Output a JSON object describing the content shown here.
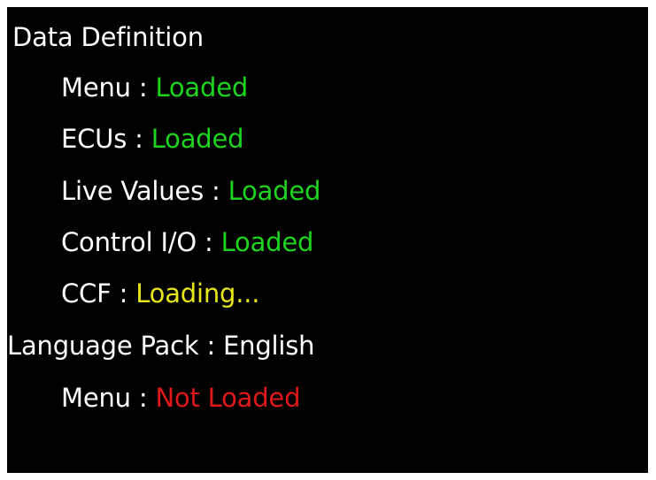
{
  "colors": {
    "background": "#000000",
    "label": "#ffffff",
    "loaded": "#1ed51e",
    "loading": "#e6e619",
    "not_loaded": "#e01818"
  },
  "data_definition": {
    "heading": "Data Definition",
    "items": [
      {
        "label": "Menu",
        "separator": " : ",
        "status": "Loaded",
        "state": "loaded"
      },
      {
        "label": "ECUs",
        "separator": " : ",
        "status": "Loaded",
        "state": "loaded"
      },
      {
        "label": "Live Values",
        "separator": " : ",
        "status": "Loaded",
        "state": "loaded"
      },
      {
        "label": "Control I/O",
        "separator": " : ",
        "status": "Loaded",
        "state": "loaded"
      },
      {
        "label": "CCF",
        "separator": " : ",
        "status": "Loading...",
        "state": "loading"
      }
    ]
  },
  "language_pack": {
    "label": "Language Pack",
    "separator": " : ",
    "value": "English",
    "items": [
      {
        "label": "Menu",
        "separator": " : ",
        "status": "Not Loaded",
        "state": "not_loaded"
      }
    ]
  }
}
